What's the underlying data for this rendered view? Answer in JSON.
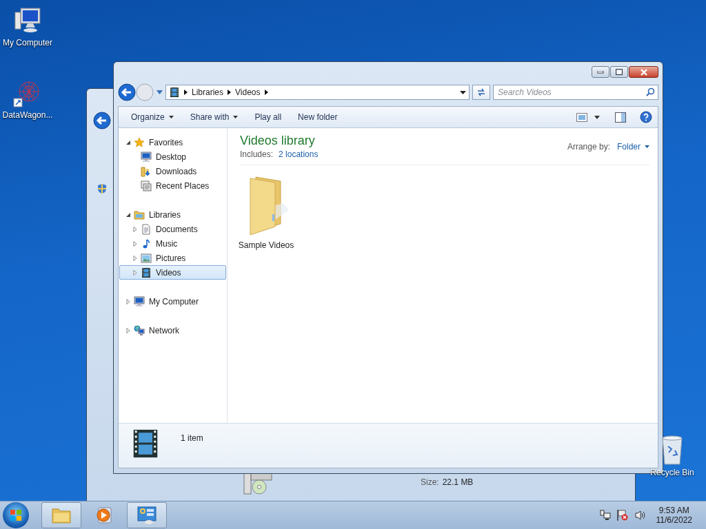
{
  "desktop_icons": [
    {
      "label": "My Computer"
    },
    {
      "label": "DataWagon..."
    },
    {
      "label": "Recycle Bin"
    }
  ],
  "background_window": {
    "size_label": "Size:",
    "size_value": "22.1 MB"
  },
  "window": {
    "breadcrumb": [
      "Libraries",
      "Videos"
    ],
    "search": {
      "placeholder": "Search Videos"
    },
    "toolbar": [
      {
        "label": "Organize",
        "dropdown": true
      },
      {
        "label": "Share with",
        "dropdown": true
      },
      {
        "label": "Play all",
        "dropdown": false
      },
      {
        "label": "New folder",
        "dropdown": false
      }
    ],
    "sidebar": [
      {
        "label": "Favorites",
        "expanded": true,
        "selected": false,
        "children": [
          {
            "label": "Desktop",
            "selected": false
          },
          {
            "label": "Downloads",
            "selected": false
          },
          {
            "label": "Recent Places",
            "selected": false
          }
        ]
      },
      {
        "label": "Libraries",
        "expanded": true,
        "selected": false,
        "children": [
          {
            "label": "Documents",
            "expanded": false,
            "selected": false
          },
          {
            "label": "Music",
            "expanded": false,
            "selected": false
          },
          {
            "label": "Pictures",
            "expanded": false,
            "selected": false
          },
          {
            "label": "Videos",
            "expanded": false,
            "selected": true
          }
        ]
      },
      {
        "label": "My Computer",
        "expanded": false,
        "selected": false
      },
      {
        "label": "Network",
        "expanded": false,
        "selected": false
      }
    ],
    "library": {
      "title": "Videos library",
      "includes_label": "Includes:",
      "includes_link": "2 locations",
      "arrange_label": "Arrange by:",
      "arrange_value": "Folder"
    },
    "items": [
      {
        "label": "Sample Videos",
        "selected": false
      }
    ],
    "details": {
      "count": "1 item"
    }
  },
  "taskbar": {
    "buttons": [
      {
        "running": true
      },
      {
        "running": false
      },
      {
        "running": true
      }
    ],
    "time": "9:53 AM",
    "date": "11/6/2022"
  }
}
